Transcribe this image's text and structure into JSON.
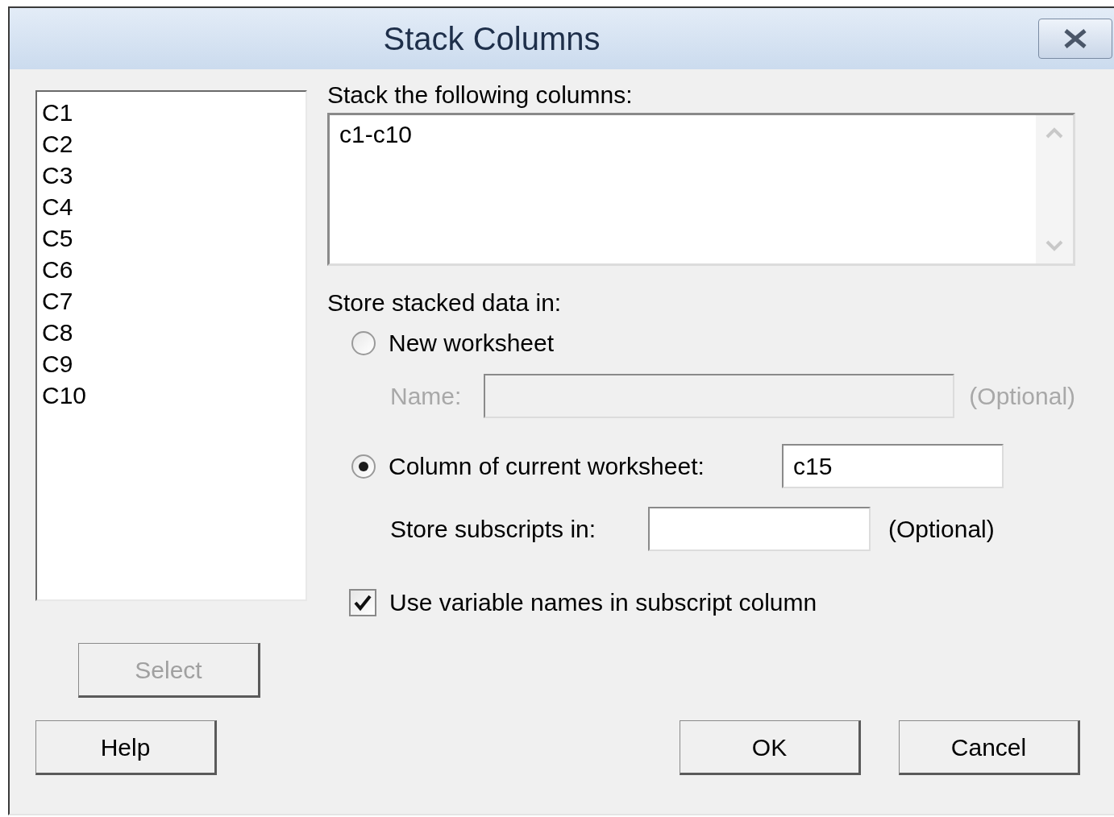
{
  "window": {
    "title": "Stack Columns"
  },
  "columns_list": {
    "items": [
      "C1",
      "C2",
      "C3",
      "C4",
      "C5",
      "C6",
      "C7",
      "C8",
      "C9",
      "C10"
    ]
  },
  "stack_field": {
    "label": "Stack the following columns:",
    "value": "c1-c10"
  },
  "store_group": {
    "label": "Store stacked data in:",
    "options": [
      {
        "label": "New worksheet",
        "selected": false
      },
      {
        "label": "Column of current worksheet:",
        "selected": true,
        "value": "c15"
      }
    ],
    "name_field": {
      "label": "Name:",
      "hint": "(Optional)",
      "disabled": true
    }
  },
  "subscripts": {
    "label": "Store subscripts in:",
    "hint": "(Optional)"
  },
  "use_names": {
    "label": "Use variable names in subscript column",
    "checked": true
  },
  "select_button": {
    "label": "Select",
    "disabled": true
  },
  "buttons": [
    {
      "label": "Help"
    },
    {
      "label": "OK"
    },
    {
      "label": "Cancel"
    }
  ]
}
